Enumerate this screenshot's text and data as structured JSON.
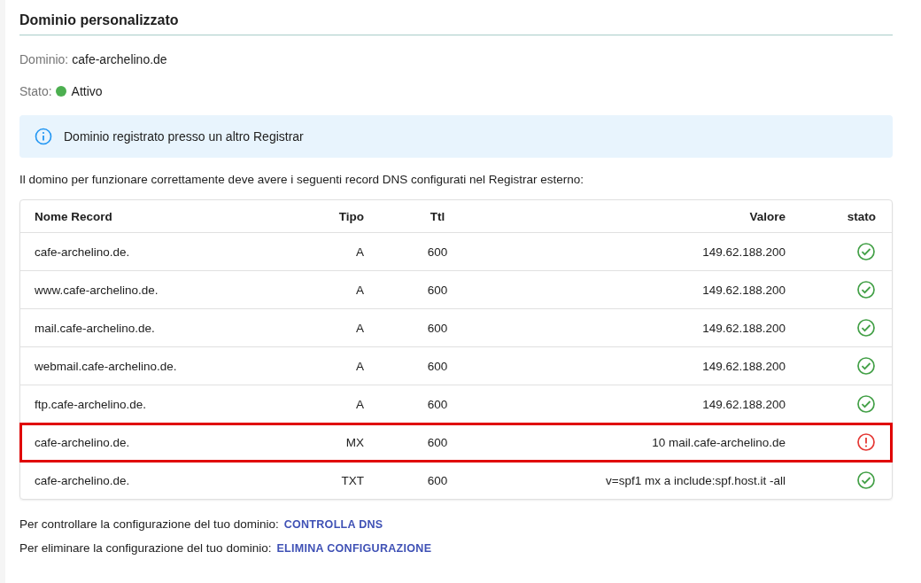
{
  "title": "Dominio personalizzato",
  "domain": {
    "label": "Dominio:",
    "value": "cafe-archelino.de"
  },
  "status": {
    "label": "Stato:",
    "value": "Attivo",
    "color": "#4caf50"
  },
  "alert": {
    "kind": "info",
    "text": "Dominio registrato presso un altro Registrar"
  },
  "intro": "Il domino per funzionare correttamente deve avere i seguenti record DNS configurati nel Registrar esterno:",
  "table": {
    "columns": [
      "Nome Record",
      "Tipo",
      "Ttl",
      "Valore",
      "stato"
    ],
    "rows": [
      {
        "name": "cafe-archelino.de.",
        "type": "A",
        "ttl": "600",
        "value": "149.62.188.200",
        "kind": "ok",
        "highlighted": false
      },
      {
        "name": "www.cafe-archelino.de.",
        "type": "A",
        "ttl": "600",
        "value": "149.62.188.200",
        "kind": "ok",
        "highlighted": false
      },
      {
        "name": "mail.cafe-archelino.de.",
        "type": "A",
        "ttl": "600",
        "value": "149.62.188.200",
        "kind": "ok",
        "highlighted": false
      },
      {
        "name": "webmail.cafe-archelino.de.",
        "type": "A",
        "ttl": "600",
        "value": "149.62.188.200",
        "kind": "ok",
        "highlighted": false
      },
      {
        "name": "ftp.cafe-archelino.de.",
        "type": "A",
        "ttl": "600",
        "value": "149.62.188.200",
        "kind": "ok",
        "highlighted": false
      },
      {
        "name": "cafe-archelino.de.",
        "type": "MX",
        "ttl": "600",
        "value": "10 mail.cafe-archelino.de",
        "kind": "error",
        "highlighted": true
      },
      {
        "name": "cafe-archelino.de.",
        "type": "TXT",
        "ttl": "600",
        "value": "v=spf1 mx a include:spf.host.it -all",
        "kind": "ok",
        "highlighted": false
      }
    ]
  },
  "actions": [
    {
      "text": "Per controllare la configurazione del tuo dominio:",
      "link": "CONTROLLA DNS"
    },
    {
      "text": "Per eliminare la configurazione del tuo dominio:",
      "link": "ELIMINA CONFIGURAZIONE"
    }
  ]
}
